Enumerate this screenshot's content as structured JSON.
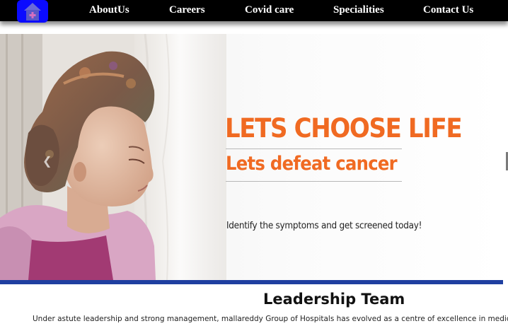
{
  "nav": {
    "logo_icon": "hospital-house-icon",
    "items": [
      {
        "label": "AboutUs"
      },
      {
        "label": "Careers"
      },
      {
        "label": "Covid care"
      },
      {
        "label": "Specialities"
      },
      {
        "label": "Contact Us"
      }
    ]
  },
  "hero": {
    "title": "LETS CHOOSE LIFE",
    "subtitle": "Lets defeat cancer",
    "tagline": "Identify the symptoms and get screened today!",
    "accent_color": "#f06a22",
    "prev_icon": "chevron-left-icon"
  },
  "leadership": {
    "heading": "Leadership Team",
    "intro": "Under astute leadership and strong management, mallareddy Group of Hospitals has evolved as a centre of excellence in medicine pr"
  },
  "colors": {
    "nav_bg": "#000000",
    "logo_bg": "#0b0bff",
    "band": "#1f3fa0"
  }
}
